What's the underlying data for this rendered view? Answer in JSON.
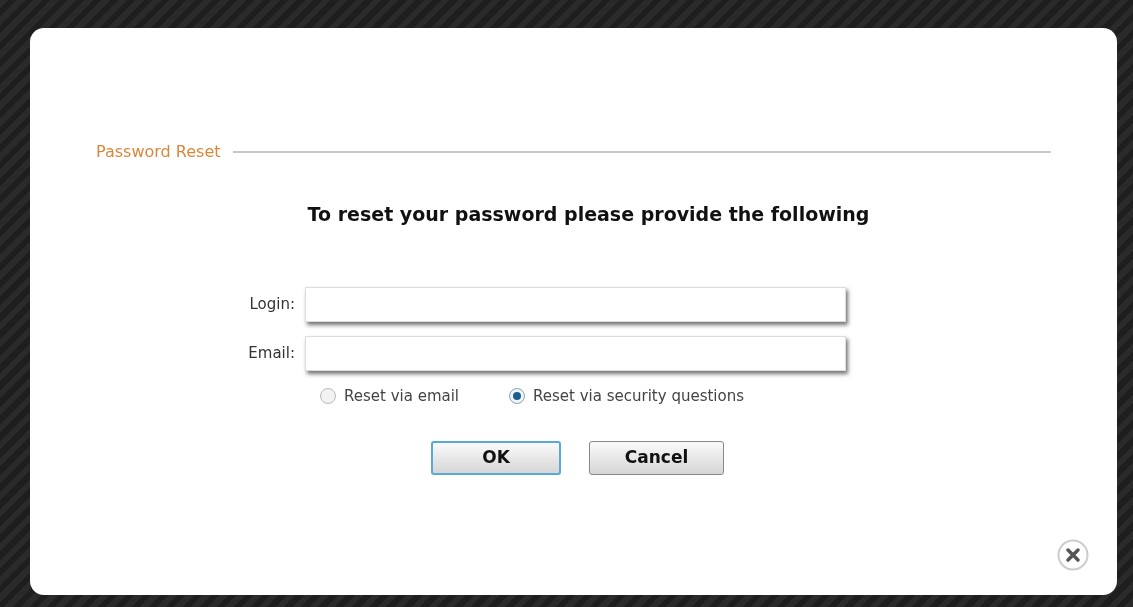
{
  "dialog": {
    "legend": "Password Reset",
    "heading": "To reset your password please provide the following",
    "fields": [
      {
        "label": "Login:"
      },
      {
        "label": "Email:"
      }
    ],
    "options": [
      {
        "label": "Reset via email",
        "selected": false
      },
      {
        "label": "Reset via security questions",
        "selected": true
      }
    ],
    "buttons": [
      {
        "label": "OK",
        "focused": true
      },
      {
        "label": "Cancel",
        "focused": false
      }
    ]
  }
}
